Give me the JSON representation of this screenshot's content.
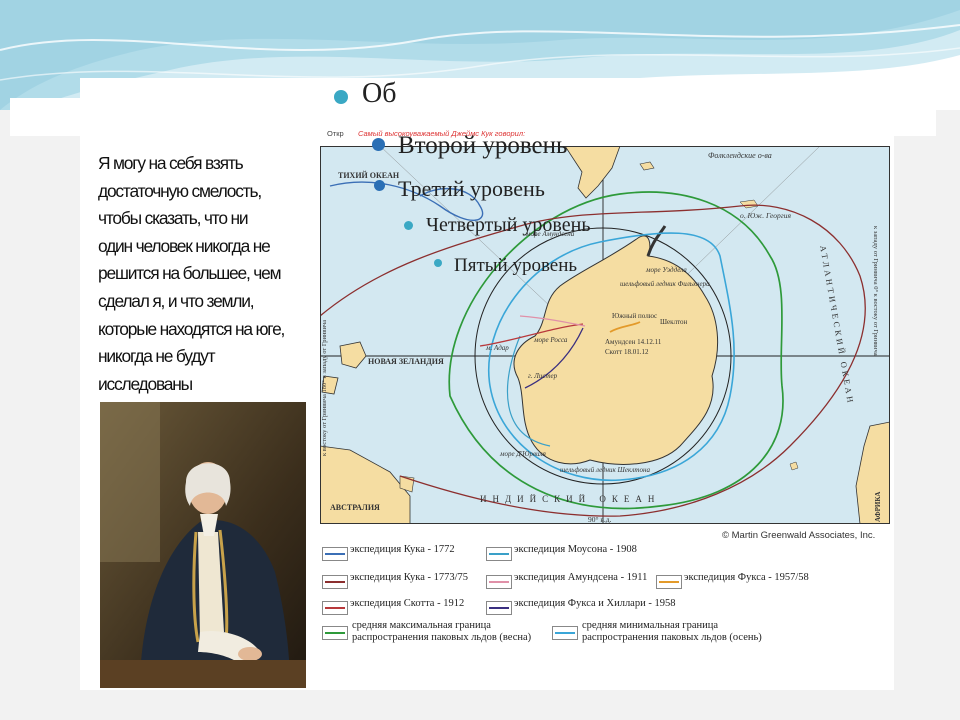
{
  "slide": {
    "title_partial": "Об",
    "bullets": [
      "Второй уровень",
      "Третий уровень",
      "Четвертый уровень",
      "Пятый уровень"
    ],
    "quote_lines": [
      "Я могу на себя взять",
      "достаточную смелость,",
      "чтобы сказать, что ни",
      "один человек никогда не",
      "решится на большее, чем",
      "сделал я, и что земли,",
      "которые находятся на юге,",
      "никогда не будут",
      "исследованы"
    ]
  },
  "map": {
    "caption_left": "Откр",
    "caption": "Самый высокоуважаемый Джеймс Кук говорил:",
    "credit": "© Martin Greenwald Associates, Inc.",
    "labels": {
      "pacific": "ТИХИЙ ОКЕАН",
      "falkland": "Фолклендские о-ва",
      "south_georgia": "о. Юж. Георгия",
      "atlantic": "АТЛАНТИЧЕСКИЙ ОКЕАН",
      "indian": "ИНДИЙСКИЙ ОКЕАН",
      "new_zealand": "НОВАЯ ЗЕЛАНДИЯ",
      "australia": "АВСТРАЛИЯ",
      "africa": "АФРИКА",
      "amundsen_sea": "море Амундсена",
      "ross_sea": "море Росса",
      "weddell_sea": "море Уэддела",
      "filchner": "шельфовый ледник Фильхнера",
      "shackleton_land": "Шеклтон",
      "south_pole": "Южный полюс",
      "amundsen_date": "Амундсен 14.12.11",
      "scott_date": "Скотт 18.01.12",
      "adare": "м. Адар",
      "lister": "г. Листер",
      "dumont": "море Д'Юрвиля",
      "shackleton_shelf": "шельфовый ледник Шеклтона",
      "deg90": "90° в.д.",
      "west_side": "к западу от Гринвича 0° к востоку от Гринвича",
      "east_side": "к востоку от Гринвича 180° к западу от Гринвича"
    },
    "route_colors": {
      "cook_1772": "#3b6fb6",
      "cook_1773": "#8c2f2f",
      "scott": "#b8383b",
      "mawson": "#3aa0c8",
      "amundsen": "#e090a8",
      "fuchs": "#e39a2a",
      "fuchs_hillary": "#3a2f80",
      "ice_max": "#2e9a3a",
      "ice_min": "#3aa6d8"
    }
  },
  "legend": [
    {
      "label": "экспедиция Кука - 1772",
      "color": "#3b6fb6"
    },
    {
      "label": "экспедиция Моусона - 1908",
      "color": "#3aa0c8"
    },
    {
      "label": "экспедиция Кука - 1773/75",
      "color": "#8c2f2f"
    },
    {
      "label": "экспедиция Амундсена - 1911",
      "color": "#e090a8"
    },
    {
      "label": "экспедиция Фукса - 1957/58",
      "color": "#e39a2a"
    },
    {
      "label": "экспедиция Скотта - 1912",
      "color": "#b8383b"
    },
    {
      "label": "экспедиция Фукса и Хиллари - 1958",
      "color": "#3a2f80"
    },
    {
      "label": "средняя максимальная граница",
      "label2": "распространения паковых льдов (весна)",
      "color": "#2e9a3a"
    },
    {
      "label": "средняя минимальная граница",
      "label2": "распространения паковых льдов (осень)",
      "color": "#3aa6d8"
    }
  ]
}
